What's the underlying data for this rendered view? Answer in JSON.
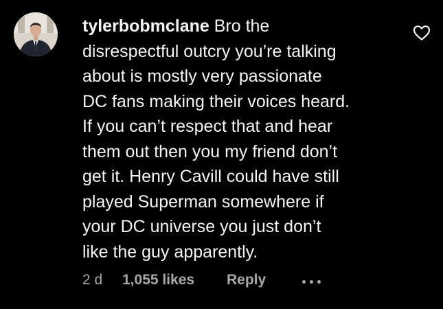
{
  "comment": {
    "username": "tylerbobmclane",
    "text_lines": [
      " Bro the",
      "disrespectful outcry you’re talking",
      "about is mostly very passionate",
      "DC fans making their voices heard.",
      "If you can’t respect that and hear",
      "them out then you my friend don’t",
      "get it. Henry Cavill could have still",
      "played Superman somewhere if",
      "your DC universe you just don’t",
      "like the guy apparently."
    ],
    "timestamp": "2 d",
    "likes": "1,055 likes",
    "reply_label": "Reply"
  },
  "icons": {
    "like": "heart-outline-icon",
    "more": "more-horizontal-icon"
  },
  "colors": {
    "background": "#000000",
    "primary_text": "#f5f5f5",
    "secondary_text": "#a8a8a8"
  }
}
